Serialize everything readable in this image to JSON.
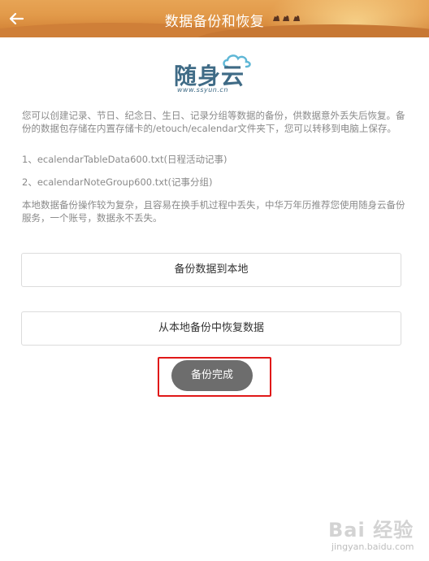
{
  "header": {
    "title": "数据备份和恢复",
    "background": "#e29a4a"
  },
  "logo": {
    "text": "随身云",
    "domain": "www.ssyun.cn"
  },
  "content": {
    "intro": "您可以创建记录、节日、纪念日、生日、记录分组等数据的备份，供数据意外丢失后恢复。备份的数据包存储在内置存储卡的/etouch/ecalendar文件夹下，您可以转移到电脑上保存。",
    "file1": "1、ecalendarTableData600.txt(日程活动记事)",
    "file2": "2、ecalendarNoteGroup600.txt(记事分组)",
    "note": "本地数据备份操作较为复杂，且容易在换手机过程中丢失，中华万年历推荐您使用随身云备份服务，一个账号，数据永不丢失。"
  },
  "buttons": {
    "backup": "备份数据到本地",
    "restore": "从本地备份中恢复数据",
    "done": "备份完成"
  },
  "annotation": {
    "color": "#e01818"
  },
  "watermark": {
    "text": "Bai 经验",
    "url": "jingyan.baidu.com"
  }
}
